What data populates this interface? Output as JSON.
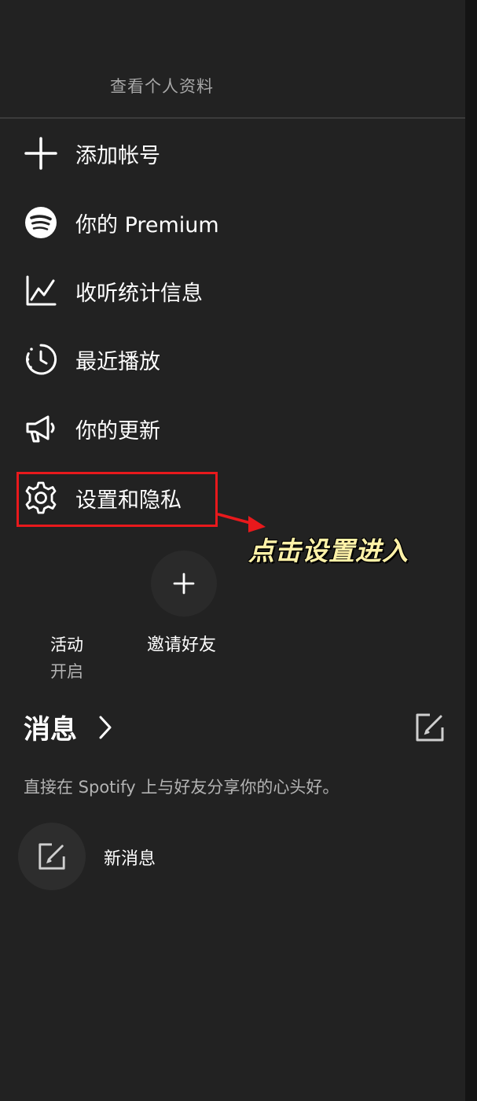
{
  "profile": {
    "view_profile": "查看个人资料"
  },
  "menu": {
    "items": [
      {
        "label": "添加帐号",
        "icon": "plus-icon"
      },
      {
        "label": "你的 Premium",
        "icon": "spotify-logo-icon"
      },
      {
        "label": "收听统计信息",
        "icon": "chart-line-icon"
      },
      {
        "label": "最近播放",
        "icon": "clock-history-icon"
      },
      {
        "label": "你的更新",
        "icon": "megaphone-icon"
      },
      {
        "label": "设置和隐私",
        "icon": "gear-icon"
      }
    ]
  },
  "annotation": {
    "text": "点击设置进入",
    "box_color": "#e8191c",
    "text_color": "#fff2a8"
  },
  "activity": {
    "label": "活动",
    "status": "开启"
  },
  "invite": {
    "label": "邀请好友"
  },
  "messages": {
    "title": "消息",
    "description": "直接在 Spotify 上与好友分享你的心头好。",
    "new_message": "新消息"
  },
  "colors": {
    "background": "#222222",
    "text": "#ffffff",
    "muted": "#b3b3b3",
    "accent": "#e8191c"
  }
}
